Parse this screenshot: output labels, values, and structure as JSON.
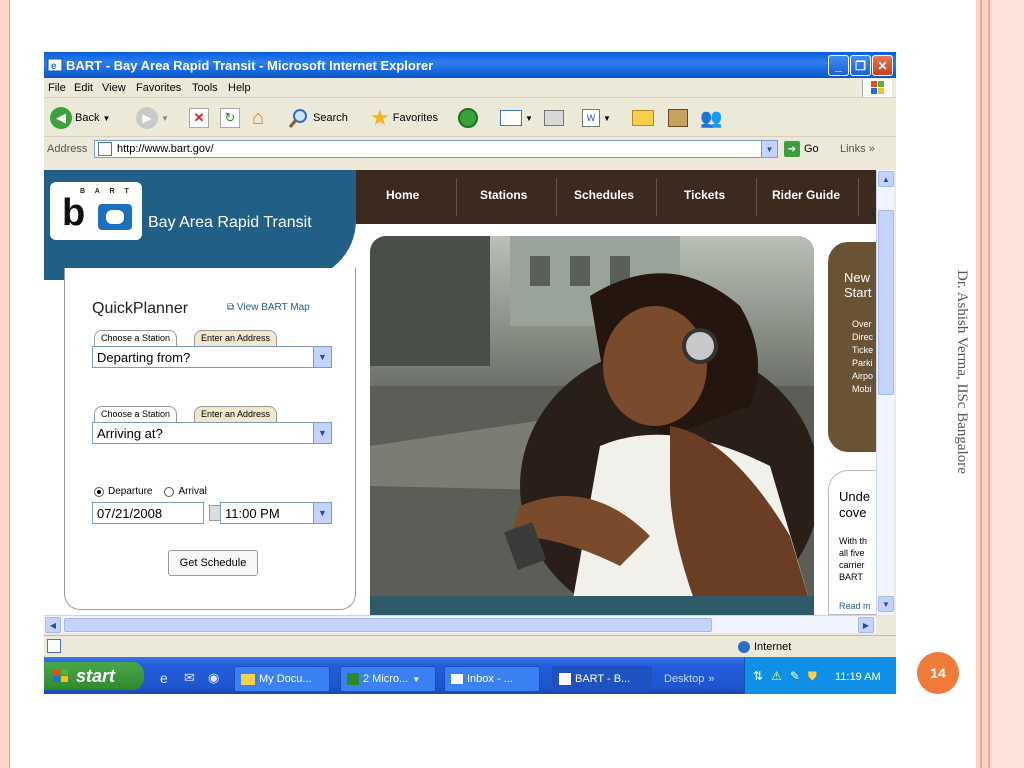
{
  "slide": {
    "author": "Dr. Ashish Verma, IISc Bangalore",
    "page_number": "14"
  },
  "window": {
    "title": "BART - Bay Area Rapid Transit - Microsoft Internet Explorer",
    "menu": [
      "File",
      "Edit",
      "View",
      "Favorites",
      "Tools",
      "Help"
    ],
    "toolbar": {
      "back": "Back",
      "search": "Search",
      "favorites": "Favorites"
    },
    "address_label": "Address",
    "url": "http://www.bart.gov/",
    "go": "Go",
    "links": "Links",
    "status_zone": "Internet"
  },
  "site": {
    "logo_text": "B A R T",
    "brand": "Bay Area Rapid Transit",
    "nav": [
      "Home",
      "Stations",
      "Schedules",
      "Tickets",
      "Rider Guide"
    ],
    "quickplanner": {
      "title": "QuickPlanner",
      "view_map": "View BART Map",
      "tab_station": "Choose a Station",
      "tab_address": "Enter an Address",
      "from": "Departing from?",
      "to": "Arriving at?",
      "departure": "Departure",
      "arrival": "Arrival",
      "date": "07/21/2008",
      "time": "11:00 PM",
      "button": "Get Schedule"
    },
    "side1": {
      "title1": "New",
      "title2": "Start",
      "items": [
        "Over",
        "Direc",
        "Ticke",
        "Parki",
        "Airpo",
        "Mobi"
      ]
    },
    "side2": {
      "title1": "Unde",
      "title2": "cove",
      "body": [
        "With th",
        "all five",
        "carrier",
        "BART"
      ],
      "read": "Read m"
    }
  },
  "taskbar": {
    "start": "start",
    "items": [
      "My Docu...",
      "2 Micro...",
      "Inbox - ...",
      "BART - B..."
    ],
    "desktop": "Desktop",
    "time": "11:19 AM"
  },
  "colors": {
    "title_blue": "#0a5fd8",
    "bart_blue": "#215f86",
    "nav_brown": "#3c2a1e",
    "accent_orange": "#f07a3a"
  }
}
